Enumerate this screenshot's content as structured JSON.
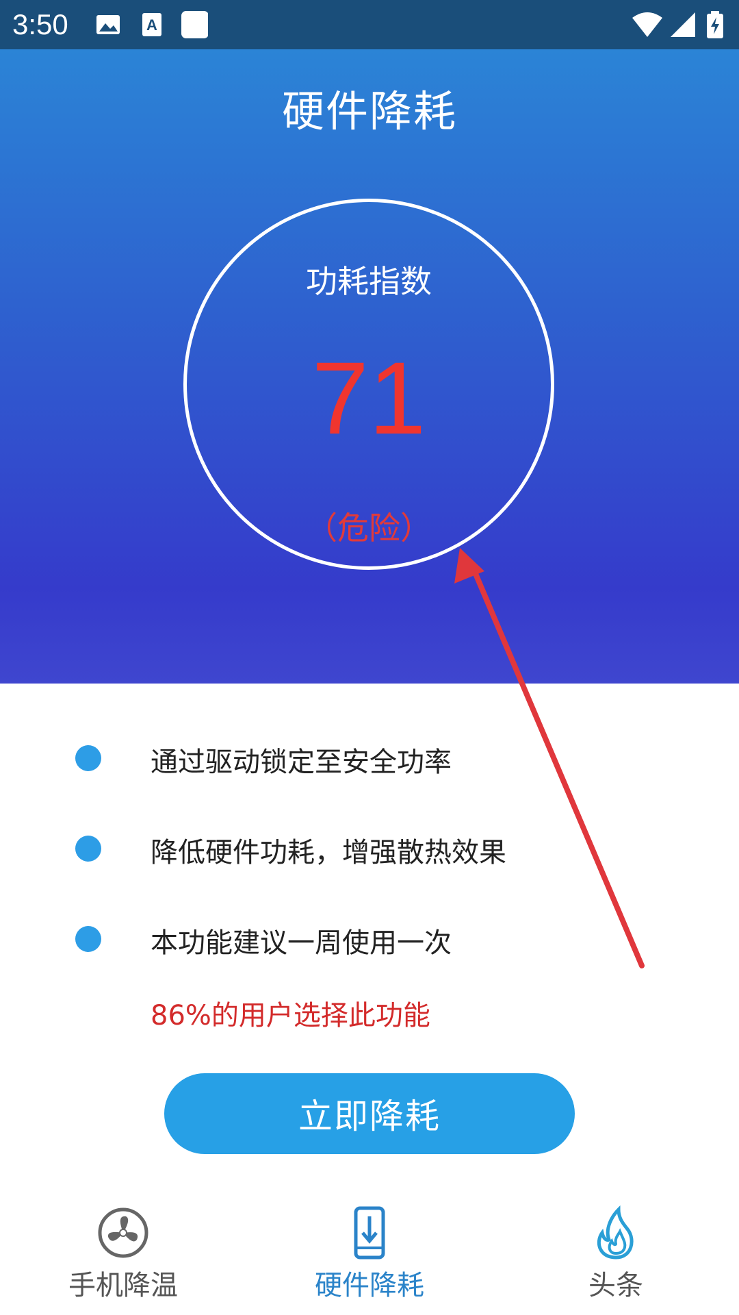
{
  "status_bar": {
    "time": "3:50",
    "icons": [
      "image-icon",
      "text-a-icon",
      "notification-square-icon",
      "wifi-icon",
      "signal-icon",
      "battery-icon"
    ]
  },
  "page": {
    "title": "硬件降耗"
  },
  "gauge": {
    "label": "功耗指数",
    "value": "71",
    "status": "（危险）",
    "value_color": "#f0352e"
  },
  "features": [
    {
      "text": "通过驱动锁定至安全功率"
    },
    {
      "text": "降低硬件功耗，增强散热效果"
    },
    {
      "text": "本功能建议一周使用一次"
    }
  ],
  "stat_text": "86%的用户选择此功能",
  "cta": {
    "label": "立即降耗"
  },
  "bottom_nav": {
    "items": [
      {
        "label": "手机降温",
        "icon": "fan-icon",
        "active": false,
        "color": "#555555"
      },
      {
        "label": "硬件降耗",
        "icon": "phone-download-icon",
        "active": true,
        "color": "#2a83c9"
      },
      {
        "label": "头条",
        "icon": "flame-icon",
        "active": false,
        "color": "#555555"
      }
    ]
  },
  "colors": {
    "hero_top": "#2b84d6",
    "hero_bottom": "#3f46cf",
    "accent": "#27a0e6",
    "annotation_arrow": "#e0373c"
  }
}
